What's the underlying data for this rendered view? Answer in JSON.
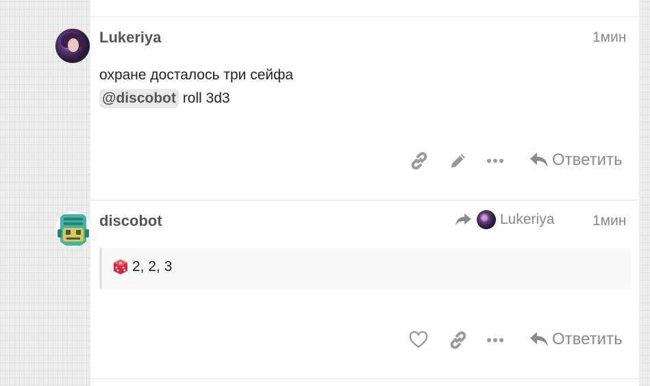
{
  "posts": [
    {
      "username": "Lukeriya",
      "time": "1мин",
      "line1": "охране досталось три сейфа",
      "mention": "@discobot",
      "line2_rest": " roll 3d3",
      "reply_label": "Ответить"
    },
    {
      "username": "discobot",
      "time": "1мин",
      "reply_to_username": "Lukeriya",
      "dice_result": "2, 2, 3",
      "reply_label": "Ответить"
    }
  ],
  "colors": {
    "panel_bg": "#ffffff",
    "page_bg": "#ececec",
    "icon_gray": "#9a9a9a",
    "discobot_teal": "#3fb5a8",
    "dice_red": "#d9263a"
  },
  "icons": [
    "link-icon",
    "pencil-icon",
    "more-dots-icon",
    "reply-icon",
    "heart-icon",
    "reply-arrow-icon",
    "dice-icon"
  ]
}
